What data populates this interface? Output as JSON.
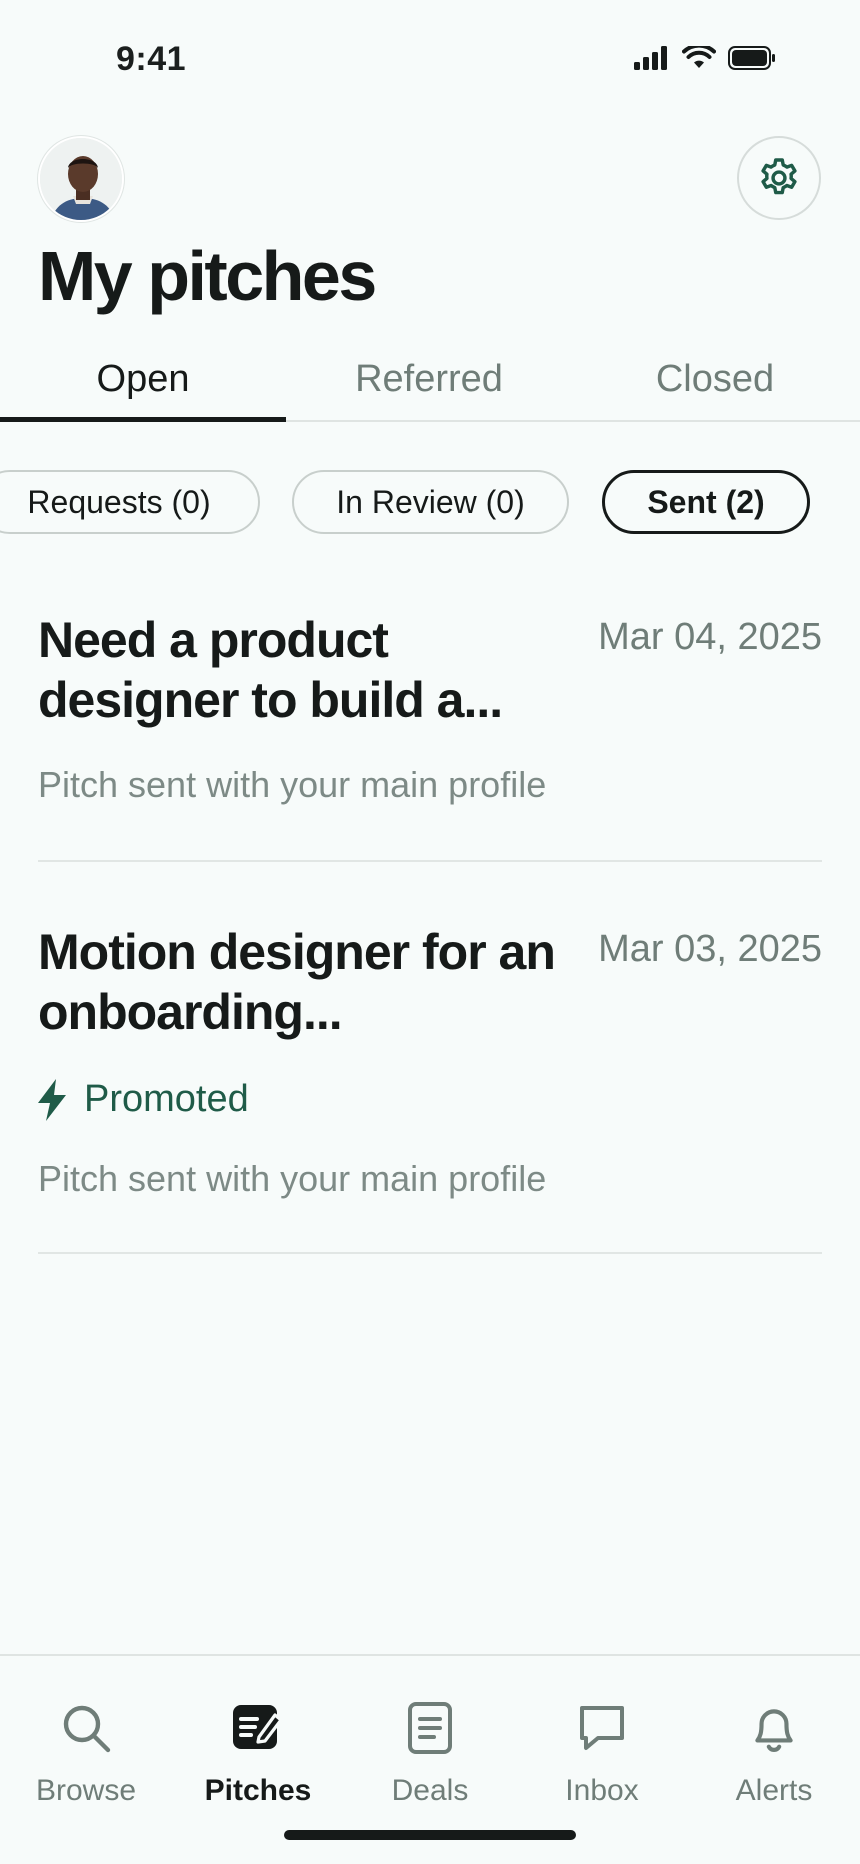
{
  "status_bar": {
    "time": "9:41"
  },
  "header": {
    "title": "My pitches"
  },
  "tabs": [
    {
      "label": "Open",
      "active": true
    },
    {
      "label": "Referred",
      "active": false
    },
    {
      "label": "Closed",
      "active": false
    }
  ],
  "filters": [
    {
      "label": "Requests (0)",
      "selected": false
    },
    {
      "label": "In Review (0)",
      "selected": false
    },
    {
      "label": "Sent (2)",
      "selected": true
    }
  ],
  "pitches": [
    {
      "title": "Need a product designer to build a...",
      "date": "Mar 04, 2025",
      "subtitle": "Pitch sent with your main profile",
      "promoted": false
    },
    {
      "title": "Motion designer for an onboarding...",
      "date": "Mar 03, 2025",
      "badge": "Promoted",
      "subtitle": "Pitch sent with your main profile",
      "promoted": true
    }
  ],
  "nav": [
    {
      "label": "Browse",
      "icon": "search-icon",
      "active": false
    },
    {
      "label": "Pitches",
      "icon": "pitches-icon",
      "active": true
    },
    {
      "label": "Deals",
      "icon": "document-icon",
      "active": false
    },
    {
      "label": "Inbox",
      "icon": "chat-bubble-icon",
      "active": false
    },
    {
      "label": "Alerts",
      "icon": "bell-icon",
      "active": false
    }
  ],
  "colors": {
    "background": "#f7fbfa",
    "text_primary": "#161a19",
    "text_muted": "#6f7d78",
    "accent_green": "#1f5b48"
  }
}
